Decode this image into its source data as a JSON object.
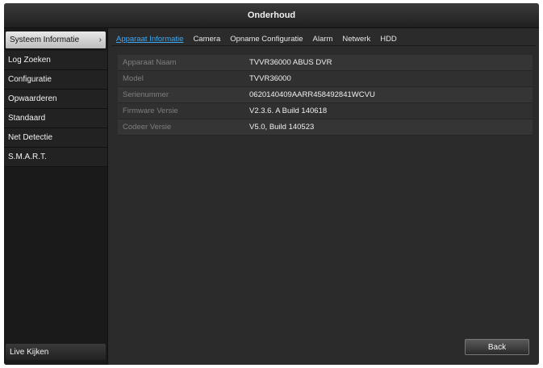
{
  "window": {
    "title": "Onderhoud"
  },
  "sidebar": {
    "items": [
      {
        "label": "Systeem Informatie"
      },
      {
        "label": "Log Zoeken"
      },
      {
        "label": "Configuratie"
      },
      {
        "label": "Opwaarderen"
      },
      {
        "label": "Standaard"
      },
      {
        "label": "Net Detectie"
      },
      {
        "label": "S.M.A.R.T."
      }
    ],
    "active_index": 0,
    "chevron": "›",
    "bottom_label": "Live Kijken"
  },
  "tabs": [
    {
      "label": "Apparaat Informatie"
    },
    {
      "label": "Camera"
    },
    {
      "label": "Opname Configuratie"
    },
    {
      "label": "Alarm"
    },
    {
      "label": "Netwerk"
    },
    {
      "label": "HDD"
    }
  ],
  "device_info": [
    {
      "key": "Apparaat Naam",
      "value": "TVVR36000 ABUS DVR"
    },
    {
      "key": "Model",
      "value": "TVVR36000"
    },
    {
      "key": "Serienummer",
      "value": "0620140409AARR458492841WCVU"
    },
    {
      "key": "Firmware Versie",
      "value": "V2.3.6. A Build 140618"
    },
    {
      "key": "Codeer Versie",
      "value": "V5.0, Build 140523"
    }
  ],
  "footer": {
    "back_label": "Back"
  },
  "colors": {
    "accent": "#3fa9f5",
    "background": "#2b2b2b"
  }
}
